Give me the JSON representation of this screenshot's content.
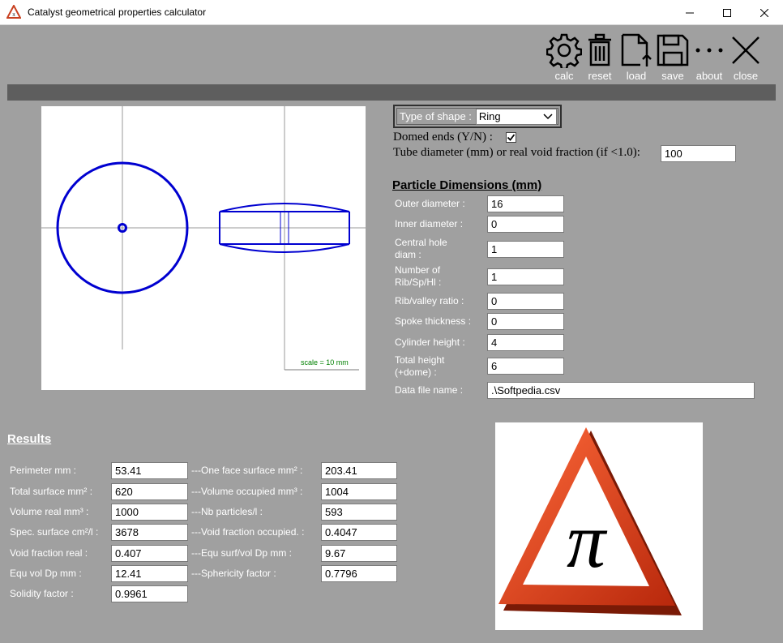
{
  "window": {
    "title": "Catalyst geometrical properties calculator"
  },
  "toolbar": {
    "calc": "calc",
    "reset": "reset",
    "load": "load",
    "save": "save",
    "about": "about",
    "close": "close"
  },
  "drawing": {
    "scale_label": "scale = 10 mm"
  },
  "shape": {
    "label": "Type of shape :",
    "selected": "Ring",
    "domed_label": "Domed ends (Y/N) :",
    "domed_checked": true,
    "tube_label": "Tube diameter (mm) or real void fraction (if <1.0):",
    "tube_value": "100"
  },
  "dimensions": {
    "title": "Particle Dimensions (mm)",
    "fields": [
      {
        "label": "Outer diameter :",
        "value": "16"
      },
      {
        "label": "Inner diameter :",
        "value": "0"
      },
      {
        "label": "Central hole diam :",
        "value": "1"
      },
      {
        "label": "Number of Rib/Sp/Hl :",
        "value": "1"
      },
      {
        "label": "Rib/valley ratio :",
        "value": "0"
      },
      {
        "label": "Spoke thickness :",
        "value": "0"
      },
      {
        "label": "Cylinder height :",
        "value": "4"
      },
      {
        "label": "Total height (+dome) :",
        "value": "6"
      },
      {
        "label": "Data file name :",
        "value": ".\\Softpedia.csv"
      }
    ]
  },
  "results": {
    "title": "Results",
    "left": [
      {
        "label": "Perimeter mm :",
        "value": "53.41"
      },
      {
        "label": "Total surface mm² :",
        "value": "620"
      },
      {
        "label": "Volume real mm³ :",
        "value": "1000"
      },
      {
        "label": "Spec. surface cm²/l :",
        "value": "3678"
      },
      {
        "label": "Void fraction real :",
        "value": "0.407"
      },
      {
        "label": "Equ vol Dp mm :",
        "value": "12.41"
      },
      {
        "label": "Solidity factor :",
        "value": "0.9961"
      }
    ],
    "right": [
      {
        "label": "---One face surface mm² :",
        "value": "203.41"
      },
      {
        "label": "---Volume occupied mm³ :",
        "value": "1004"
      },
      {
        "label": "---Nb particles/l :",
        "value": "593"
      },
      {
        "label": "---Void fraction occupied. :",
        "value": "0.4047"
      },
      {
        "label": "---Equ surf/vol Dp mm :",
        "value": "9.67"
      },
      {
        "label": "---Sphericity factor :",
        "value": "0.7796"
      }
    ]
  },
  "colors": {
    "background": "#a0a0a0",
    "strip": "#5e5e5e",
    "shape_stroke": "#0000d0",
    "scale_text": "#008000"
  }
}
